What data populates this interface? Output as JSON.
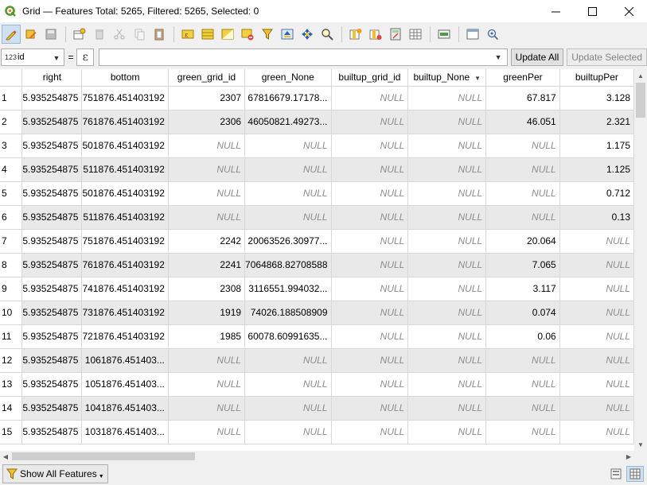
{
  "window": {
    "title": "Grid — Features Total: 5265, Filtered: 5265, Selected: 0",
    "logo_icon": "qgis-logo-icon",
    "buttons": [
      "minimize-icon",
      "maximize-icon",
      "close-icon"
    ]
  },
  "toolbar": {
    "icons": [
      "toggle-editing-icon",
      "multi-edit-icon",
      "save-edits-icon",
      "reload-table-icon",
      "delete-features-icon",
      "cut-icon",
      "copy-icon",
      "paste-icon",
      "select-by-expression-icon",
      "select-all-icon",
      "invert-selection-icon",
      "deselect-all-icon",
      "filter-selection-icon",
      "move-selection-top-icon",
      "pan-to-selection-icon",
      "zoom-to-selection-icon",
      "new-field-icon",
      "delete-field-icon",
      "field-calculator-icon",
      "conditional-formatting-icon",
      "actions-icon",
      "dock-table-icon",
      "toggle-docked-icon"
    ]
  },
  "expression_bar": {
    "field_type": "123",
    "field_value": "id",
    "equals": "=",
    "epsilon": "ε",
    "expression_value": "",
    "update_all_label": "Update All",
    "update_selected_label": "Update Selected"
  },
  "table": {
    "columns": [
      {
        "label": "right",
        "sorted": false
      },
      {
        "label": "bottom",
        "sorted": false
      },
      {
        "label": "green_grid_id",
        "sorted": false
      },
      {
        "label": "green_None",
        "sorted": false
      },
      {
        "label": "builtup_grid_id",
        "sorted": false
      },
      {
        "label": "builtup_None",
        "sorted": true
      },
      {
        "label": "greenPer",
        "sorted": false
      },
      {
        "label": "builtupPer",
        "sorted": false
      }
    ],
    "rows": [
      {
        "n": "1",
        "cells": [
          "5.935254875",
          "751876.451403192",
          "2307",
          "67816679.17178...",
          "NULL",
          "NULL",
          "67.817",
          "3.128"
        ]
      },
      {
        "n": "2",
        "cells": [
          "5.935254875",
          "761876.451403192",
          "2306",
          "46050821.49273...",
          "NULL",
          "NULL",
          "46.051",
          "2.321"
        ]
      },
      {
        "n": "3",
        "cells": [
          "5.935254875",
          "501876.451403192",
          "NULL",
          "NULL",
          "NULL",
          "NULL",
          "NULL",
          "1.175"
        ]
      },
      {
        "n": "4",
        "cells": [
          "5.935254875",
          "511876.451403192",
          "NULL",
          "NULL",
          "NULL",
          "NULL",
          "NULL",
          "1.125"
        ]
      },
      {
        "n": "5",
        "cells": [
          "5.935254875",
          "501876.451403192",
          "NULL",
          "NULL",
          "NULL",
          "NULL",
          "NULL",
          "0.712"
        ]
      },
      {
        "n": "6",
        "cells": [
          "5.935254875",
          "511876.451403192",
          "NULL",
          "NULL",
          "NULL",
          "NULL",
          "NULL",
          "0.13"
        ]
      },
      {
        "n": "7",
        "cells": [
          "5.935254875",
          "751876.451403192",
          "2242",
          "20063526.30977...",
          "NULL",
          "NULL",
          "20.064",
          "NULL"
        ]
      },
      {
        "n": "8",
        "cells": [
          "5.935254875",
          "761876.451403192",
          "2241",
          "7064868.82708588",
          "NULL",
          "NULL",
          "7.065",
          "NULL"
        ]
      },
      {
        "n": "9",
        "cells": [
          "5.935254875",
          "741876.451403192",
          "2308",
          "3116551.994032...",
          "NULL",
          "NULL",
          "3.117",
          "NULL"
        ]
      },
      {
        "n": "10",
        "cells": [
          "5.935254875",
          "731876.451403192",
          "1919",
          "74026.188508909",
          "NULL",
          "NULL",
          "0.074",
          "NULL"
        ]
      },
      {
        "n": "11",
        "cells": [
          "5.935254875",
          "721876.451403192",
          "1985",
          "60078.60991635...",
          "NULL",
          "NULL",
          "0.06",
          "NULL"
        ]
      },
      {
        "n": "12",
        "cells": [
          "5.935254875",
          "1061876.451403...",
          "NULL",
          "NULL",
          "NULL",
          "NULL",
          "NULL",
          "NULL"
        ]
      },
      {
        "n": "13",
        "cells": [
          "5.935254875",
          "1051876.451403...",
          "NULL",
          "NULL",
          "NULL",
          "NULL",
          "NULL",
          "NULL"
        ]
      },
      {
        "n": "14",
        "cells": [
          "5.935254875",
          "1041876.451403...",
          "NULL",
          "NULL",
          "NULL",
          "NULL",
          "NULL",
          "NULL"
        ]
      },
      {
        "n": "15",
        "cells": [
          "5.935254875",
          "1031876.451403...",
          "NULL",
          "NULL",
          "NULL",
          "NULL",
          "NULL",
          "NULL"
        ]
      }
    ]
  },
  "status": {
    "show_features_label": "Show All Features",
    "view_icons": [
      "form-view-icon",
      "table-view-icon"
    ]
  },
  "colors": {
    "null_text": "#8e8e8e",
    "alt_row": "#e9e9e9",
    "active_button": "#cfe0f2"
  }
}
